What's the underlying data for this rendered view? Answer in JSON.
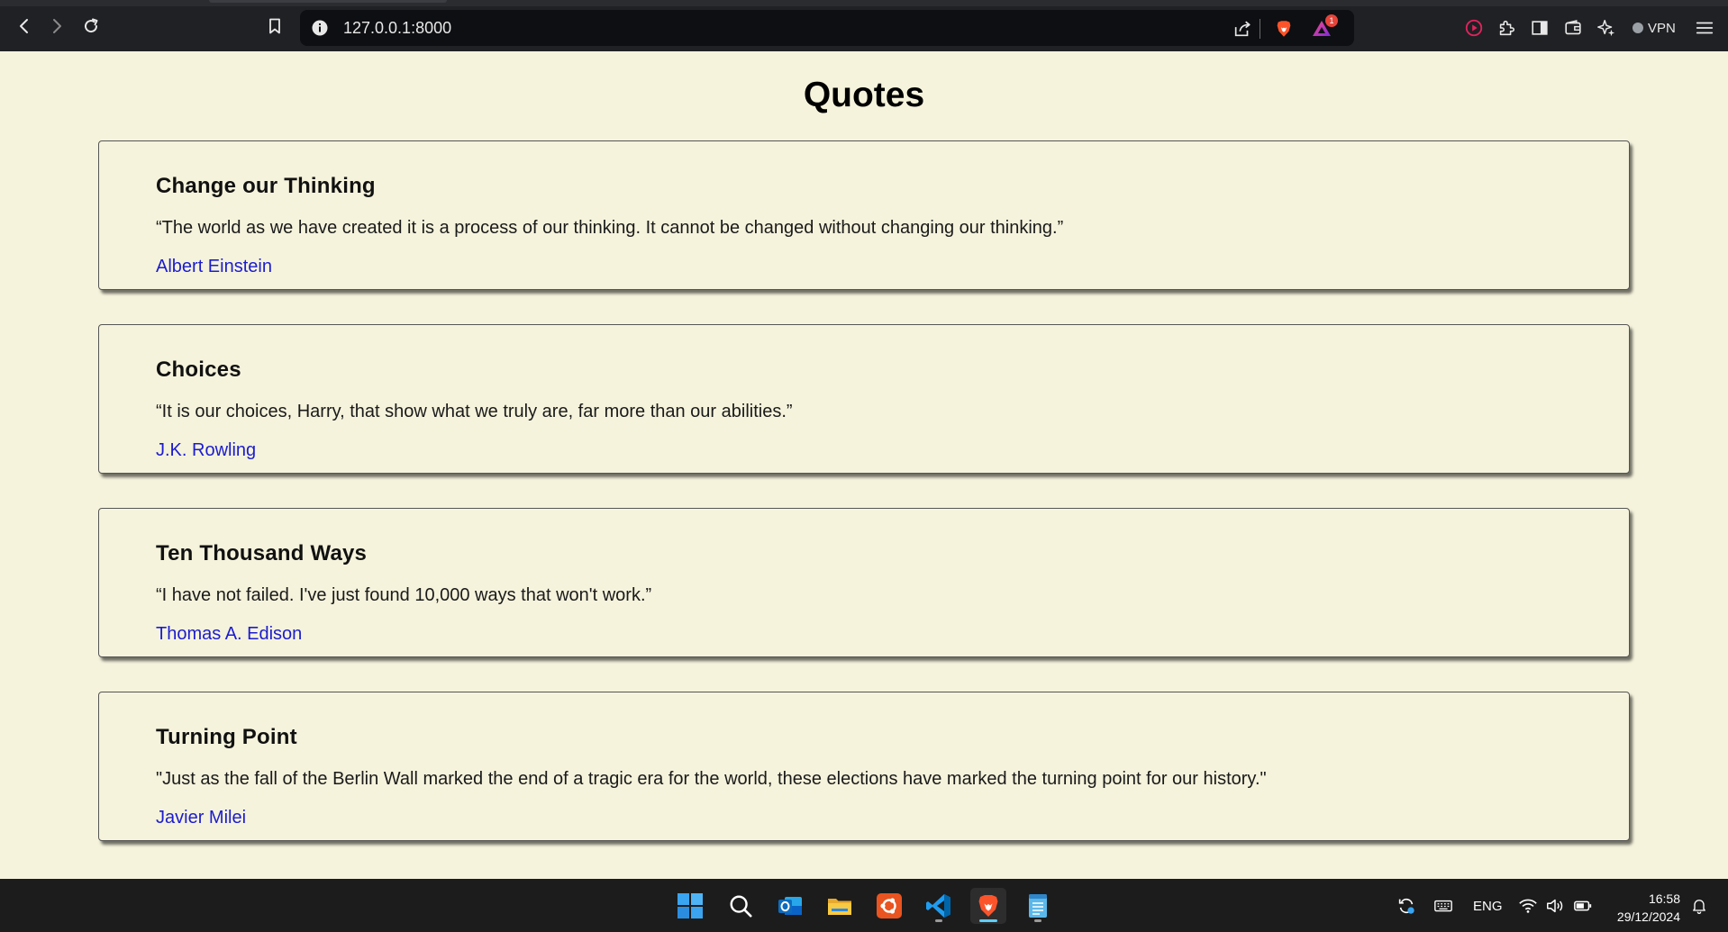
{
  "browser": {
    "url": "127.0.0.1:8000",
    "notification_count": "1",
    "vpn_label": "VPN"
  },
  "page": {
    "title": "Quotes"
  },
  "quotes": [
    {
      "title": "Change our Thinking",
      "text": "“The world as we have created it is a process of our thinking. It cannot be changed without changing our thinking.”",
      "author": "Albert Einstein"
    },
    {
      "title": "Choices",
      "text": "“It is our choices, Harry, that show what we truly are, far more than our abilities.”",
      "author": "J.K. Rowling"
    },
    {
      "title": "Ten Thousand Ways",
      "text": "“I have not failed. I've just found 10,000 ways that won't work.”",
      "author": "Thomas A. Edison"
    },
    {
      "title": "Turning Point",
      "text": "\"Just as the fall of the Berlin Wall marked the end of a tragic era for the world, these elections have marked the turning point for our history.\"",
      "author": "Javier Milei"
    }
  ],
  "taskbar": {
    "language": "ENG",
    "time": "16:58",
    "date": "29/12/2024",
    "apps": [
      "windows-start",
      "search",
      "outlook",
      "file-explorer",
      "ubuntu",
      "vscode",
      "brave",
      "notepad"
    ]
  },
  "colors": {
    "page_background": "#f5f3dc",
    "author_link": "#1c1ccf",
    "chrome_background": "#202124",
    "taskbar_background": "#1c1c1c",
    "brave_orange": "#fb542b"
  }
}
